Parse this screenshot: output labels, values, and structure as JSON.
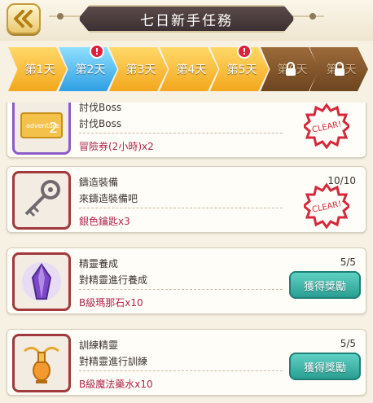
{
  "header": {
    "title": "七日新手任務"
  },
  "tabs": [
    {
      "label": "第1天",
      "state": "gold",
      "badge": ""
    },
    {
      "label": "第2天",
      "state": "blue",
      "badge": "!"
    },
    {
      "label": "第3天",
      "state": "gold",
      "badge": ""
    },
    {
      "label": "第4天",
      "state": "gold",
      "badge": ""
    },
    {
      "label": "第5天",
      "state": "gold",
      "badge": "!"
    },
    {
      "label": "第6天",
      "state": "locked",
      "badge": ""
    },
    {
      "label": "第7天",
      "state": "locked",
      "badge": ""
    }
  ],
  "quests": [
    {
      "title": "討伐Boss",
      "desc": "討伐Boss",
      "reward": "冒險券(2小時)x2",
      "progress": "",
      "status": "clear",
      "icon": "adventure-ticket-icon"
    },
    {
      "title": "鑄造裝備",
      "desc": "來鑄造裝備吧",
      "reward": "銀色鑰匙x3",
      "progress": "10/10",
      "status": "clear",
      "icon": "silver-key-icon"
    },
    {
      "title": "精靈養成",
      "desc": "對精靈進行養成",
      "reward": "B級瑪那石x10",
      "progress": "5/5",
      "status": "claim",
      "icon": "mana-stone-icon"
    },
    {
      "title": "訓練精靈",
      "desc": "對精靈進行訓練",
      "reward": "B級魔法藥水x10",
      "progress": "5/5",
      "status": "claim",
      "icon": "magic-potion-icon"
    }
  ],
  "labels": {
    "clear": "CLEAR!",
    "claim": "獲得獎勵",
    "ticket_text": "adventure",
    "ticket_num": "2"
  },
  "colors": {
    "tab_gold": "#f3a71d",
    "tab_active": "#2e9fe3",
    "tab_locked": "#6d4520",
    "reward_text": "#b0254a",
    "claim_button": "#2a9e92",
    "clear_stamp": "#d6283c"
  }
}
